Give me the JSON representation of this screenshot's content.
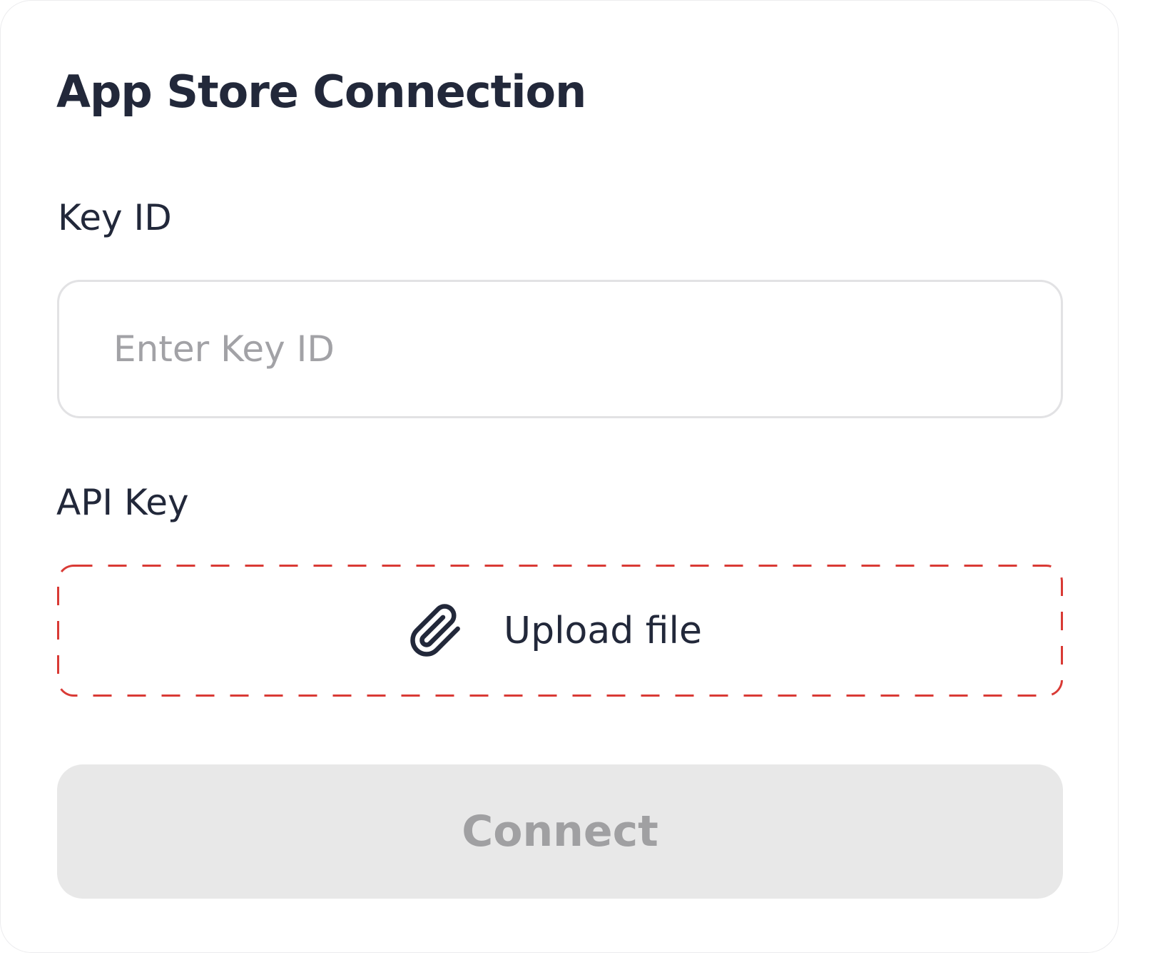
{
  "dialog": {
    "title": "App Store Connection"
  },
  "key_id": {
    "label": "Key ID",
    "value": "",
    "placeholder": "Enter Key ID"
  },
  "api_key": {
    "label": "API Key",
    "upload_label": "Upload file",
    "upload_icon": "paperclip-icon",
    "border_color": "#d93a35"
  },
  "actions": {
    "connect_label": "Connect",
    "connect_enabled": false
  },
  "colors": {
    "text_primary": "#22283a",
    "placeholder": "#a2a2a6",
    "input_border": "#e2e2e4",
    "button_disabled_bg": "#e8e8e8",
    "button_disabled_text": "#a0a0a2",
    "upload_dash": "#d93a35"
  }
}
